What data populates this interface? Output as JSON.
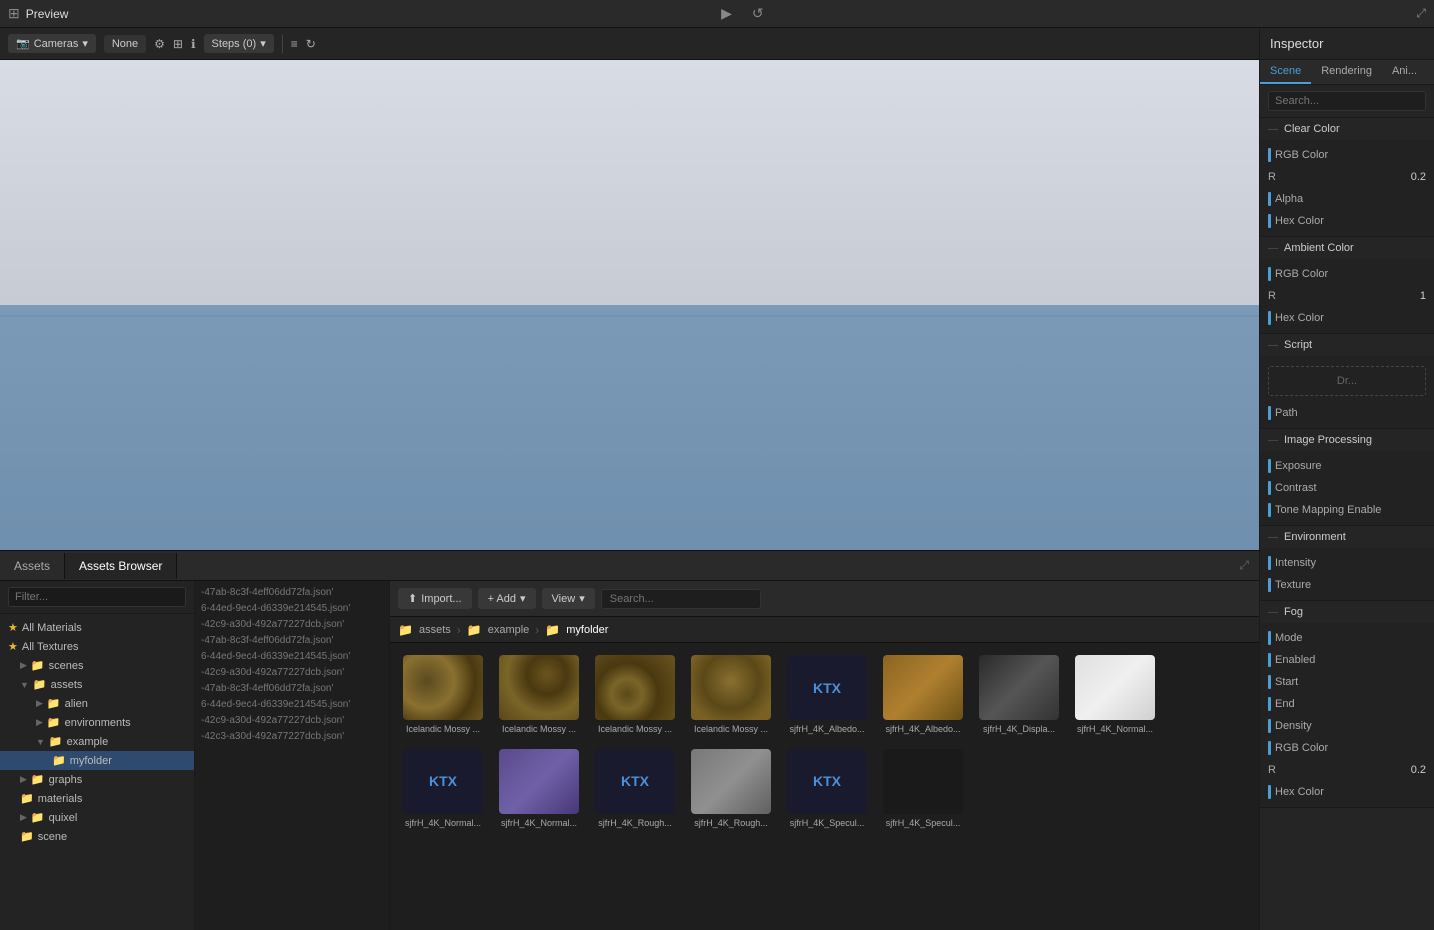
{
  "topbar": {
    "grid_icon": "⊞",
    "preview_label": "Preview",
    "expand_icon": "⤢",
    "center_btn1": "▶",
    "center_btn2": "↺"
  },
  "toolbar": {
    "camera_label": "Cameras",
    "none_label": "None",
    "steps_label": "Steps (0)",
    "icons": [
      "⚙",
      "🔲",
      "ℹ"
    ],
    "refresh_icon": "↻"
  },
  "inspector": {
    "title": "Inspector",
    "tabs": [
      "Scene",
      "Rendering",
      "Ani..."
    ],
    "search_placeholder": "Search...",
    "sections": {
      "clear_color": {
        "label": "Clear Color",
        "rgb_label": "RGB Color",
        "r_label": "R",
        "r_value": "0.2",
        "alpha_label": "Alpha",
        "hex_label": "Hex Color"
      },
      "ambient_color": {
        "label": "Ambient Color",
        "rgb_label": "RGB Color",
        "r_label": "R",
        "r_value": "1",
        "hex_label": "Hex Color"
      },
      "script": {
        "label": "Script",
        "drop_text": "Dr...",
        "path_label": "Path"
      },
      "image_processing": {
        "label": "Image Processing",
        "exposure_label": "Exposure",
        "contrast_label": "Contrast",
        "tone_mapping_label": "Tone Mapping Enable"
      },
      "environment": {
        "label": "Environment",
        "intensity_label": "Intensity",
        "texture_label": "Texture"
      },
      "fog": {
        "label": "Fog",
        "mode_label": "Mode",
        "enabled_label": "Enabled",
        "start_label": "Start",
        "end_label": "End",
        "density_label": "Density",
        "rgb_label": "RGB Color",
        "r_label": "R",
        "r_value": "0.2",
        "hex_label": "Hex Color"
      }
    }
  },
  "assets_panel": {
    "tab_assets": "Assets",
    "tab_browser": "Assets Browser",
    "filter_placeholder": "Filter...",
    "import_label": "Import...",
    "add_label": "+ Add",
    "view_label": "View",
    "search_placeholder": "Search...",
    "breadcrumbs": [
      "assets",
      "example",
      "myfolder"
    ],
    "folder_icon": "📁",
    "tree_items": [
      {
        "label": "All Materials",
        "type": "star",
        "indent": 0
      },
      {
        "label": "All Textures",
        "type": "star",
        "indent": 0
      },
      {
        "label": "scenes",
        "type": "folder",
        "indent": 1
      },
      {
        "label": "assets",
        "type": "folder",
        "indent": 1,
        "expanded": true
      },
      {
        "label": "alien",
        "type": "folder",
        "indent": 2
      },
      {
        "label": "environments",
        "type": "folder",
        "indent": 2
      },
      {
        "label": "example",
        "type": "folder",
        "indent": 2,
        "expanded": true
      },
      {
        "label": "myfolder",
        "type": "folder",
        "indent": 3,
        "selected": true
      },
      {
        "label": "graphs",
        "type": "folder",
        "indent": 1
      },
      {
        "label": "materials",
        "type": "folder",
        "indent": 1
      },
      {
        "label": "quixel",
        "type": "folder",
        "indent": 1
      },
      {
        "label": "scene",
        "type": "folder",
        "indent": 1
      }
    ],
    "assets": [
      {
        "label": "Icelandic Mossy ...",
        "thumb": "mossy-1"
      },
      {
        "label": "Icelandic Mossy ...",
        "thumb": "mossy-2"
      },
      {
        "label": "Icelandic Mossy ...",
        "thumb": "mossy-3"
      },
      {
        "label": "Icelandic Mossy ...",
        "thumb": "mossy-4"
      },
      {
        "label": "sjfrH_4K_Albedo...",
        "thumb": "ktx-dark"
      },
      {
        "label": "sjfrH_4K_Albedo...",
        "thumb": "albedo-1"
      },
      {
        "label": "sjfrH_4K_Displa...",
        "thumb": "displace"
      },
      {
        "label": "sjfrH_4K_Normal...",
        "thumb": "normal-light"
      },
      {
        "label": "sjfrH_4K_Normal...",
        "thumb": "normal-2"
      },
      {
        "label": "sjfrH_4K_Normal...",
        "thumb": "purple"
      },
      {
        "label": "sjfrH_4K_Rough...",
        "thumb": "rough-1"
      },
      {
        "label": "sjfrH_4K_Rough...",
        "thumb": "rough-2"
      },
      {
        "label": "sjfrH_4K_Specul...",
        "thumb": "ktx-dark2"
      },
      {
        "label": "sjfrH_4K_Specul...",
        "thumb": "dark"
      }
    ]
  },
  "log_items": [
    "-47ab-8c3f-4eff06dd72fa.json'",
    "6-44ed-9ec4-d6339e214545.json'",
    "-42c9-a30d-492a77227dcb.json'",
    "-47ab-8c3f-4eff06dd72fa.json'",
    "6-44ed-9ec4-d6339e214545.json'",
    "-42c9-a30d-492a77227dcb.json'",
    "-47ab-8c3f-4eff06dd72fa.json'",
    "6-44ed-9ec4-d6339e214545.json'",
    "-42c9-a30d-492a77227dcb.json'",
    "-42c3-a30d-492a77227dcb.json'"
  ]
}
